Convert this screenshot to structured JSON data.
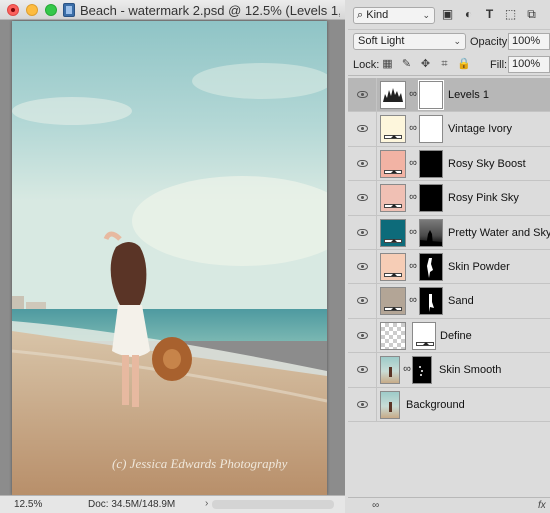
{
  "window": {
    "title": "Beach - watermark 2.psd @ 12.5% (Levels 1,..."
  },
  "canvas": {
    "watermark_text": "(c) Jessica Edwards Photography"
  },
  "status": {
    "zoom": "12.5%",
    "doc_size": "Doc: 34.5M/148.9M",
    "arrow": "›"
  },
  "layers_panel": {
    "filter_kind": "Kind",
    "filter_icons": [
      "image-filter-icon",
      "adjustment-filter-icon",
      "type-filter-icon",
      "shape-filter-icon",
      "smart-object-filter-icon"
    ],
    "blend_mode": "Soft Light",
    "opacity_label": "Opacity:",
    "opacity_value": "100%",
    "lock_label": "Lock:",
    "fill_label": "Fill:",
    "fill_value": "100%",
    "footer_fx": "fx",
    "layers": [
      {
        "name": "Levels 1",
        "selected": true,
        "thumb": "histogram",
        "mask": "white"
      },
      {
        "name": "Vintage Ivory",
        "thumb_color": "#fdf6dc",
        "mask": "white"
      },
      {
        "name": "Rosy Sky Boost",
        "thumb_color": "#f2b3a4",
        "mask": "black"
      },
      {
        "name": "Rosy Pink Sky",
        "thumb_color": "#f0c0b4",
        "mask": "black"
      },
      {
        "name": "Pretty Water and Sky",
        "thumb_color": "#0d6b7a",
        "mask": "silhouette"
      },
      {
        "name": "Skin Powder",
        "thumb_color": "#f6cdb6",
        "mask": "figure"
      },
      {
        "name": "Sand",
        "thumb_color": "#b3a596",
        "mask": "figure"
      },
      {
        "name": "Define",
        "thumb": "transparent",
        "mask": "white"
      },
      {
        "name": "Skin Smooth",
        "thumb": "photo",
        "mask": "dots"
      },
      {
        "name": "Background",
        "thumb": "photo"
      }
    ]
  }
}
